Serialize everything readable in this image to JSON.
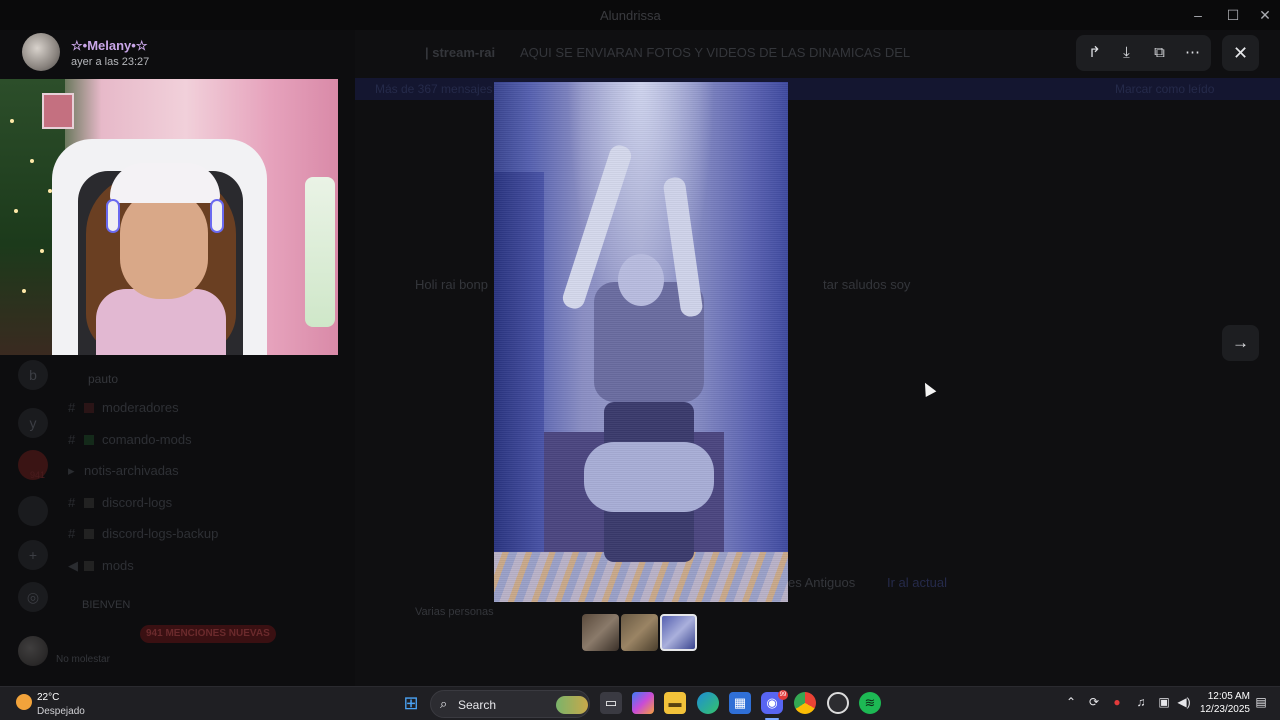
{
  "window": {
    "title": "Alundrissa"
  },
  "viewer": {
    "user_name": "☆•Melany•☆",
    "timestamp": "ayer a las 23:27",
    "actions": {
      "forward": "↱",
      "download": "⤓",
      "open": "⧉",
      "more": "⋯",
      "close": "✕",
      "next": "→"
    }
  },
  "background": {
    "server_name": "Alundrissa",
    "channel_header": "| stream-rai",
    "channel_topic": "AQUI SE ENVIARAN FOTOS Y VIDEOS DE LAS DINAMICAS DEL",
    "unread_banner": "Más de 367 mensajes",
    "mark_read": "Marcar como leído",
    "message_preview": "Holi rai bonp",
    "message_tail": "tar saludos soy",
    "older_label": "es Antiguos",
    "jump_present": "Ir al actual",
    "typing": "Varias personas",
    "category": "pauto",
    "channels": [
      {
        "name": "moderadores"
      },
      {
        "name": "comando-mods"
      },
      {
        "name": "notis-archivadas"
      },
      {
        "name": "discord-logs"
      },
      {
        "name": "discord-logs-backup"
      },
      {
        "name": "mods"
      }
    ],
    "mentions_badge": "941 MENCIONES NUEVAS",
    "mentions_prefix": "BIENVEN",
    "server_badge": "941",
    "user_status": "No molestar"
  },
  "thumbnails": [
    {
      "label": "thumb-1",
      "selected": false
    },
    {
      "label": "thumb-2",
      "selected": false
    },
    {
      "label": "thumb-3",
      "selected": true
    }
  ],
  "taskbar": {
    "weather_temp": "22°C",
    "weather_cond": "Despejado",
    "search_label": "Search",
    "discord_badge": "99",
    "time": "12:05 AM",
    "date": "12/23/2025",
    "apps": [
      "windows-icon",
      "file-icon",
      "copilot-icon",
      "explorer-icon",
      "edge-icon",
      "store-icon",
      "discord-icon",
      "chrome-icon",
      "obs-icon",
      "spotify-icon"
    ]
  }
}
